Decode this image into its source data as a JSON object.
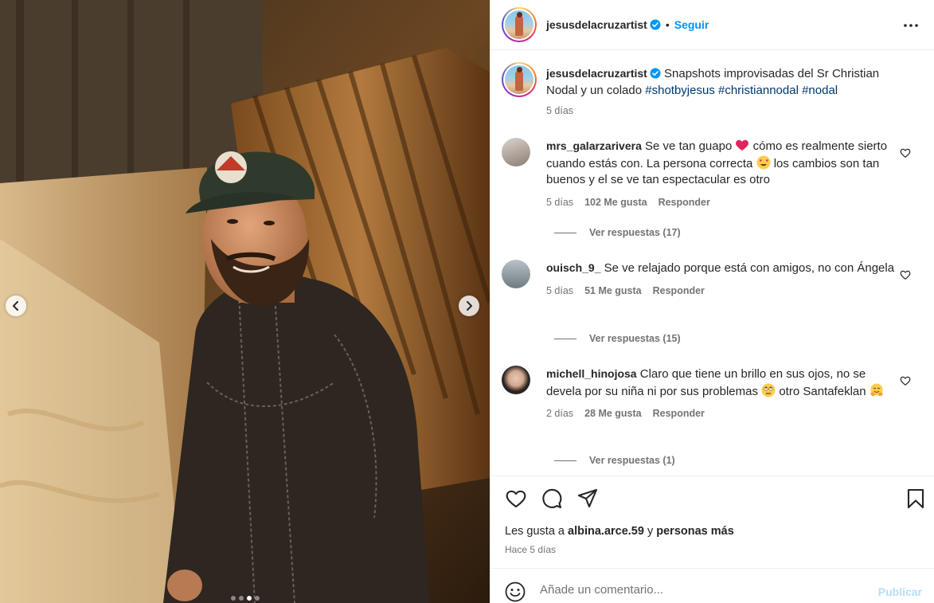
{
  "media": {
    "slide_count": 4,
    "active_slide": 3
  },
  "header": {
    "username": "jesusdelacruzartist",
    "separator": "•",
    "follow_label": "Seguir",
    "more_icon": "more-horizontal-icon"
  },
  "caption": {
    "username": "jesusdelacruzartist",
    "text": "Snapshots improvisadas del Sr Christian Nodal y un colado",
    "hashtags": [
      "#shotbyjesus",
      "#christiannodal",
      "#nodal"
    ],
    "time": "5 días"
  },
  "comments": [
    {
      "username": "mrs_galarzarivera",
      "text_a": "Se ve tan guapo",
      "text_b": "cómo es realmente sierto cuando estás con. La persona correcta",
      "text_c": "los cambios son tan buenos y el se ve tan espectacular es otro",
      "time": "5 días",
      "likes": "102 Me gusta",
      "reply_label": "Responder",
      "view_replies": "Ver respuestas (17)"
    },
    {
      "username": "ouisch_9_",
      "text_a": "Se ve relajado porque está con amigos, no con Ángela",
      "time": "5 días",
      "likes": "51 Me gusta",
      "reply_label": "Responder",
      "view_replies": "Ver respuestas (15)"
    },
    {
      "username": "michell_hinojosa",
      "text_a": "Claro que tiene un brillo en sus ojos, no se devela por su niña ni por sus problemas",
      "text_b": "otro Santafeklan",
      "time": "2 días",
      "likes": "28 Me gusta",
      "reply_label": "Responder",
      "view_replies": "Ver respuestas (1)"
    }
  ],
  "actions": {
    "icons": [
      "heart-icon",
      "comment-icon",
      "share-icon",
      "bookmark-icon"
    ],
    "likes_prefix": "Les gusta a",
    "likes_user": "albina.arce.59",
    "likes_conj": "y",
    "likes_others": "personas más",
    "time": "Hace 5 días"
  },
  "composer": {
    "placeholder": "Añade un comentario...",
    "publish_label": "Publicar"
  },
  "colors": {
    "accent": "#0095f6",
    "hashtag": "#00376b",
    "muted": "#737373",
    "publish_disabled": "#b2dffc"
  }
}
